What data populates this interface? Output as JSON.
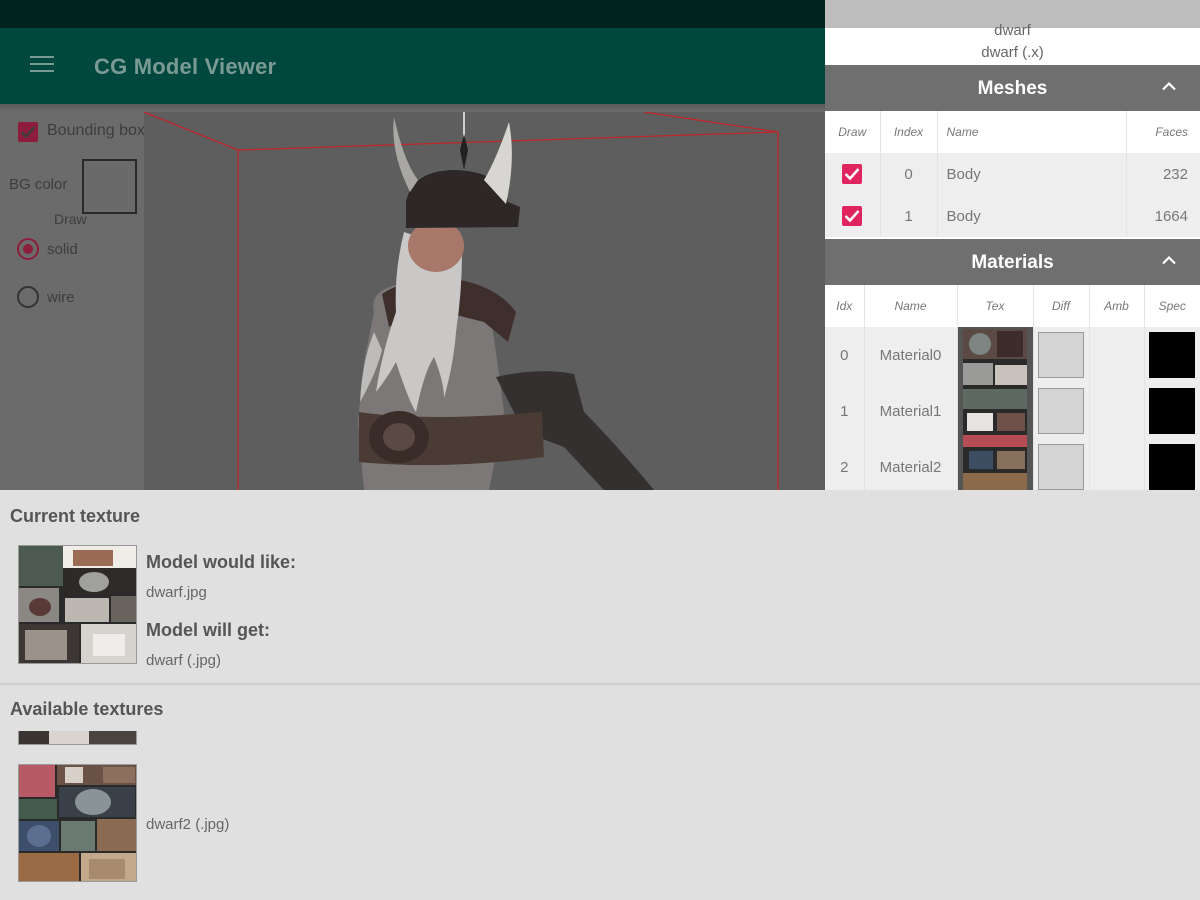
{
  "app": {
    "title": "CG Model Viewer",
    "menu_icon": "hamburger-menu-icon"
  },
  "controls": {
    "bounding_box_label": "Bounding box",
    "bounding_box_checked": true,
    "bg_color_label": "BG color",
    "draw_label": "Draw",
    "draw_options": [
      {
        "label": "solid",
        "selected": true
      },
      {
        "label": "wire",
        "selected": false
      }
    ]
  },
  "drawer": {
    "file_name": "dwarf",
    "file_type": "dwarf (.x)",
    "meshes": {
      "title": "Meshes",
      "columns": [
        "Draw",
        "Index",
        "Name",
        "Faces"
      ],
      "rows": [
        {
          "draw": true,
          "index": "0",
          "name": "Body",
          "faces": "232"
        },
        {
          "draw": true,
          "index": "1",
          "name": "Body",
          "faces": "1664"
        }
      ]
    },
    "materials": {
      "title": "Materials",
      "columns": [
        "Idx",
        "Name",
        "Tex",
        "Diff",
        "Amb",
        "Spec"
      ],
      "rows": [
        {
          "idx": "0",
          "name": "Material0"
        },
        {
          "idx": "1",
          "name": "Material1"
        },
        {
          "idx": "2",
          "name": "Material2"
        }
      ]
    }
  },
  "current_texture": {
    "heading": "Current texture",
    "would_like_label": "Model would like:",
    "would_like_value": "dwarf.jpg",
    "will_get_label": "Model will get:",
    "will_get_value": "dwarf (.jpg)"
  },
  "available_textures": {
    "heading": "Available textures",
    "items": [
      {
        "name": "dwarf2 (.jpg)"
      }
    ]
  },
  "colors": {
    "app_bar": "#00473d",
    "status_bar": "#00231d",
    "accent": "#e0245e",
    "section_header": "#6f6f6f",
    "bounding_box_line": "#c0262b"
  }
}
